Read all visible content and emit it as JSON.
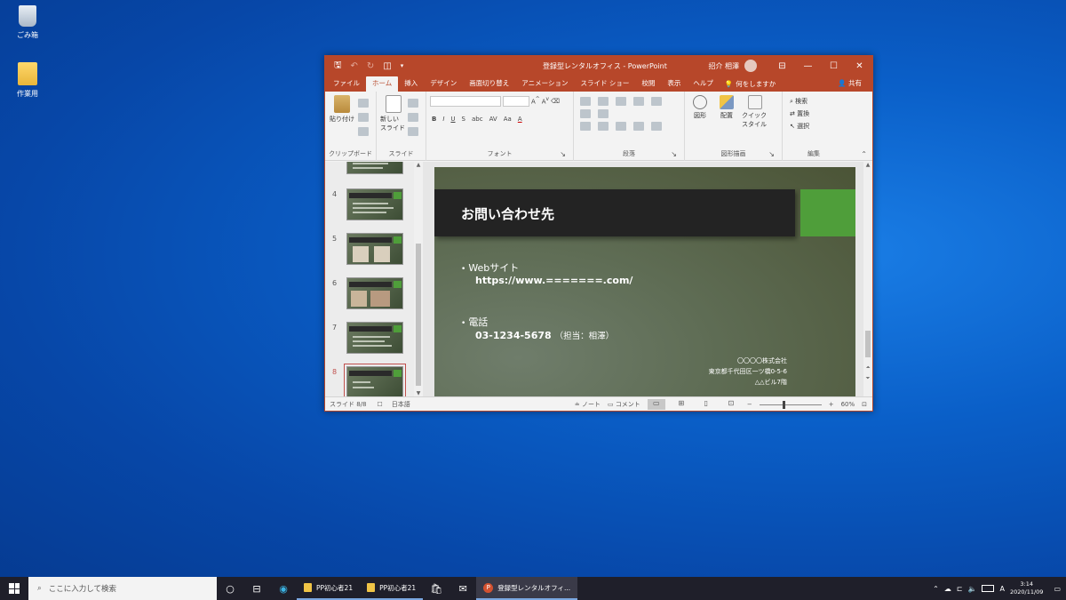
{
  "desktop": {
    "icons": [
      {
        "label": "ごみ箱",
        "icon": "recycle-bin-icon"
      },
      {
        "label": "作業用",
        "icon": "folder-icon"
      }
    ]
  },
  "window": {
    "title": "登録型レンタルオフィス - PowerPoint",
    "user": "招介 相澤",
    "qat": {
      "save": "🖫",
      "undo": "↶",
      "redo": "↻",
      "present": "◫",
      "more": "▾"
    },
    "controls": {
      "ribbon_display": "⊟",
      "minimize": "—",
      "maximize": "☐",
      "close": "✕"
    }
  },
  "tabs": {
    "items": [
      "ファイル",
      "ホーム",
      "挿入",
      "デザイン",
      "画面切り替え",
      "アニメーション",
      "スライド ショー",
      "校閲",
      "表示",
      "ヘルプ"
    ],
    "active": "ホーム",
    "search": "何をしますか",
    "share": "共有"
  },
  "ribbon": {
    "groups": [
      {
        "label": "クリップボード",
        "big": "貼り付け"
      },
      {
        "label": "スライド",
        "big": "新しい スライド"
      },
      {
        "label": "フォント"
      },
      {
        "label": "段落"
      },
      {
        "label": "図形描画",
        "items": [
          "図形",
          "配置",
          "クイック スタイル"
        ]
      },
      {
        "label": "編集",
        "items": [
          "検索",
          "置換",
          "選択"
        ]
      }
    ],
    "font_buttons": [
      "B",
      "I",
      "U",
      "S",
      "abc",
      "AV",
      "Aa",
      "A"
    ]
  },
  "thumbnails": {
    "items": [
      {
        "num": "4"
      },
      {
        "num": "5"
      },
      {
        "num": "6"
      },
      {
        "num": "7"
      },
      {
        "num": "8"
      }
    ],
    "selected": "8"
  },
  "slide": {
    "title": "お問い合わせ先",
    "bullets": [
      {
        "heading": "Webサイト",
        "detail": "https://www.=======.com/",
        "note": ""
      },
      {
        "heading": "電話",
        "detail": "03-1234-5678",
        "note": "（担当：相澤）"
      }
    ],
    "company": {
      "name": "〇〇〇〇株式会社",
      "address": "東京都千代田区一ツ橋0-5-6",
      "building": "△△ビル7階"
    }
  },
  "statusbar": {
    "slide_info": "スライド 8/8",
    "language": "日本語",
    "notes": "ノート",
    "comments": "コメント",
    "zoom": "60%"
  },
  "taskbar": {
    "search_placeholder": "ここに入力して検索",
    "apps": [
      {
        "label": "PP初心者21",
        "icon": "folder-icon"
      },
      {
        "label": "PP初心者21",
        "icon": "folder-icon"
      },
      {
        "label": "登録型レンタルオフィ...",
        "icon": "powerpoint-icon"
      }
    ],
    "time": "3:14",
    "date": "2020/11/09"
  },
  "colors": {
    "ppt_accent": "#b7472a",
    "slide_green": "#4f9e3a",
    "taskbar": "#1f1f2a"
  }
}
